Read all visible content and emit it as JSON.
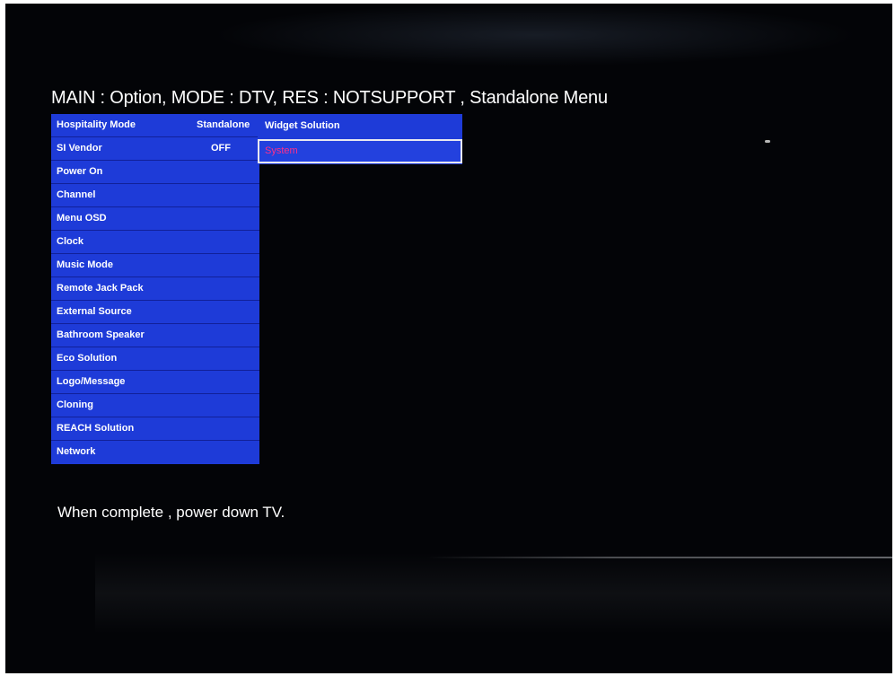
{
  "header": {
    "title": "MAIN : Option, MODE : DTV, RES : NOTSUPPORT , Standalone Menu"
  },
  "left_menu": {
    "items": [
      {
        "label": "Hospitality Mode",
        "value": "Standalone"
      },
      {
        "label": "SI Vendor",
        "value": "OFF"
      },
      {
        "label": "Power On"
      },
      {
        "label": "Channel"
      },
      {
        "label": "Menu OSD"
      },
      {
        "label": "Clock"
      },
      {
        "label": "Music Mode"
      },
      {
        "label": "Remote Jack Pack"
      },
      {
        "label": "External Source"
      },
      {
        "label": "Bathroom Speaker"
      },
      {
        "label": "Eco Solution"
      },
      {
        "label": "Logo/Message"
      },
      {
        "label": "Cloning"
      },
      {
        "label": "REACH Solution"
      },
      {
        "label": "Network"
      }
    ]
  },
  "right_menu": {
    "items": [
      {
        "label": "Widget Solution"
      },
      {
        "label": "System",
        "selected": true
      }
    ]
  },
  "footer": {
    "message": "When complete , power down TV."
  },
  "colors": {
    "menu_blue": "#1e3bd8",
    "selected_text": "#ff2f8a",
    "background": "#030407"
  }
}
